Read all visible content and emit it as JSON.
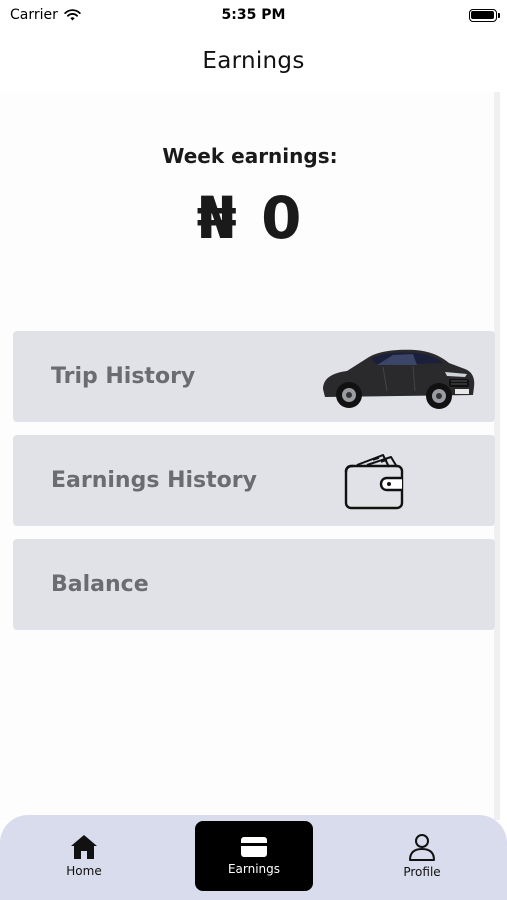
{
  "status_bar": {
    "carrier": "Carrier",
    "time": "5:35 PM"
  },
  "header": {
    "title": "Earnings"
  },
  "summary": {
    "label": "Week earnings:",
    "amount": "₦ 0"
  },
  "menu": {
    "items": [
      {
        "label": "Trip History",
        "icon": "car-icon"
      },
      {
        "label": "Earnings History",
        "icon": "wallet-icon"
      },
      {
        "label": "Balance",
        "icon": ""
      }
    ]
  },
  "tabbar": {
    "tabs": [
      {
        "label": "Home",
        "icon": "home-icon",
        "active": false
      },
      {
        "label": "Earnings",
        "icon": "card-icon",
        "active": true
      },
      {
        "label": "Profile",
        "icon": "profile-icon",
        "active": false
      }
    ]
  },
  "colors": {
    "card_bg": "#e1e2e7",
    "card_text": "#6b6c72",
    "tabbar_bg": "#d9dcec",
    "active_tab_bg": "#000000"
  }
}
